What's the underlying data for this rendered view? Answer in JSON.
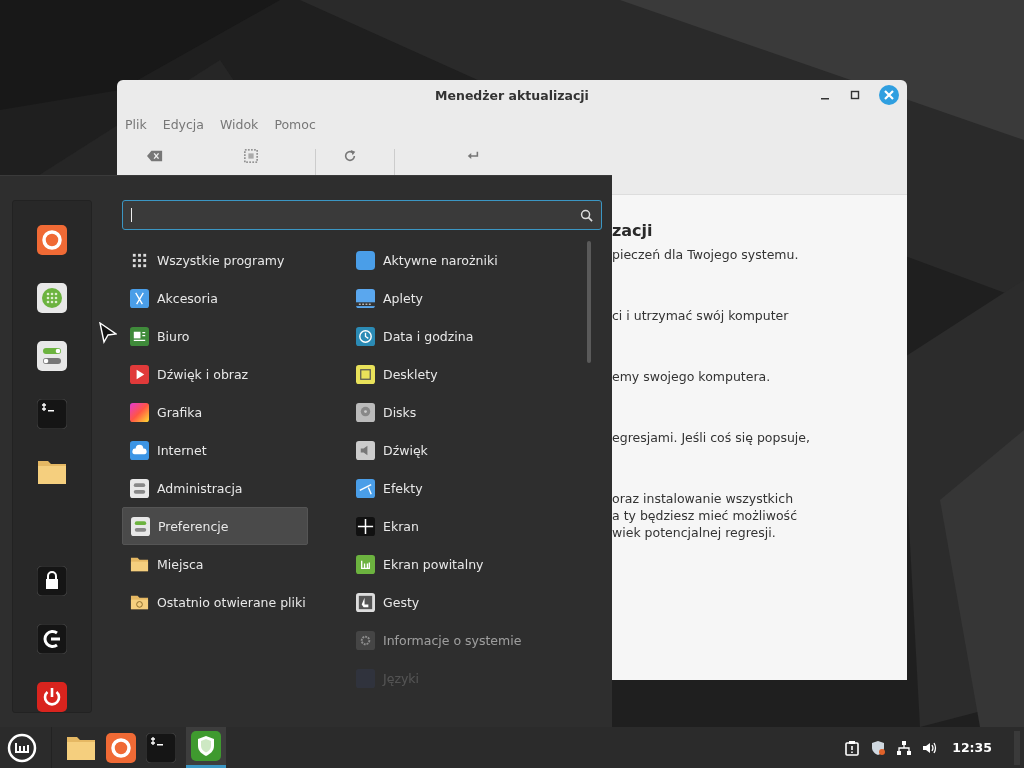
{
  "window": {
    "title": "Menedżer aktualizacji",
    "menu": [
      "Plik",
      "Edycja",
      "Widok",
      "Pomoc"
    ],
    "heading": "zacji",
    "blocks": [
      [
        "pieczeń dla Twojego systemu."
      ],
      [
        "ci i utrzymać swój komputer"
      ],
      [
        "emy swojego komputera."
      ],
      [
        "egresjami. Jeśli coś się popsuje,"
      ],
      [
        "oraz instalowanie wszystkich",
        "a ty będziesz mieć możliwość",
        "wiek potencjalnej regresji."
      ]
    ]
  },
  "menu": {
    "categories": [
      {
        "label": "Wszystkie programy",
        "selected": false
      },
      {
        "label": "Akcesoria",
        "selected": false
      },
      {
        "label": "Biuro",
        "selected": false
      },
      {
        "label": "Dźwięk i obraz",
        "selected": false
      },
      {
        "label": "Grafika",
        "selected": false
      },
      {
        "label": "Internet",
        "selected": false
      },
      {
        "label": "Administracja",
        "selected": false
      },
      {
        "label": "Preferencje",
        "selected": true
      },
      {
        "label": "Miejsca",
        "selected": false
      },
      {
        "label": "Ostatnio otwierane pliki",
        "selected": false
      }
    ],
    "apps": [
      {
        "label": "Aktywne narożniki",
        "dimmed": false
      },
      {
        "label": "Aplety",
        "dimmed": false
      },
      {
        "label": "Data i godzina",
        "dimmed": false
      },
      {
        "label": "Desklety",
        "dimmed": false
      },
      {
        "label": "Disks",
        "dimmed": false
      },
      {
        "label": "Dźwięk",
        "dimmed": false
      },
      {
        "label": "Efekty",
        "dimmed": false
      },
      {
        "label": "Ekran",
        "dimmed": false
      },
      {
        "label": "Ekran powitalny",
        "dimmed": false
      },
      {
        "label": "Gesty",
        "dimmed": false
      },
      {
        "label": "Informacje o systemie",
        "dimmed": true
      },
      {
        "label": "Języki",
        "dimmed": true
      }
    ]
  },
  "taskbar": {
    "clock": "12:35"
  }
}
